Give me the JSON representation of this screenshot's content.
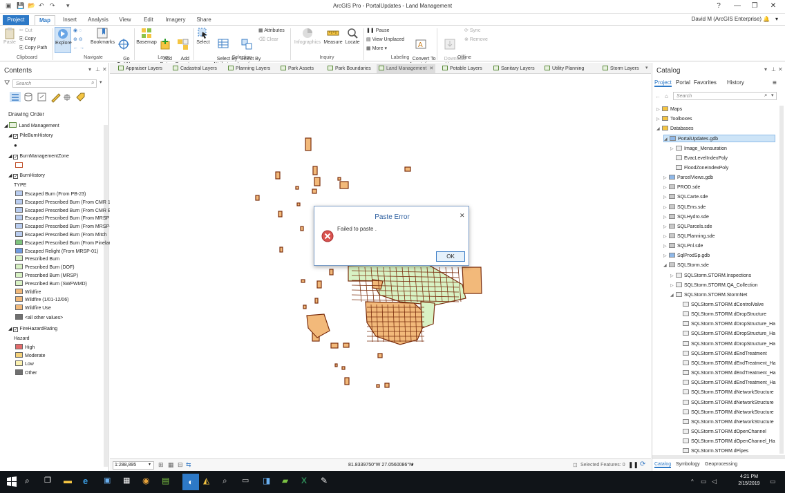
{
  "window": {
    "title": "ArcGIS Pro - PortalUpdates - Land Management",
    "user": "David M (ArcGIS Enterprise)",
    "help": "?"
  },
  "ribbon_tabs": [
    "Project",
    "Map",
    "Insert",
    "Analysis",
    "View",
    "Edit",
    "Imagery",
    "Share"
  ],
  "ribbon": {
    "clipboard": {
      "paste": "Paste",
      "cut": "Cut",
      "copy": "Copy",
      "copy_path": "Copy Path",
      "group": "Clipboard"
    },
    "navigate": {
      "explore": "Explore",
      "bookmarks": "Bookmarks",
      "goto": "Go\nTo XY",
      "group": "Navigate"
    },
    "layer": {
      "basemap": "Basemap",
      "add_data": "Add\nData",
      "add_preset": "Add\nPreset",
      "group": "Layer"
    },
    "selection": {
      "select": "Select",
      "by_attr": "Select By\nAttributes",
      "by_loc": "Select By\nLocation",
      "attributes": "Attributes",
      "clear": "Clear",
      "group": "Selection"
    },
    "inquiry": {
      "infographics": "Infographics",
      "measure": "Measure",
      "locate": "Locate",
      "group": "Inquiry"
    },
    "labeling": {
      "pause": "Pause",
      "view_unplaced": "View Unplaced",
      "more": "More",
      "convert": "Convert To\nAnnotation",
      "group": "Labeling"
    },
    "offline": {
      "download": "Download\nMap",
      "sync": "Sync",
      "remove": "Remove",
      "group": "Offline"
    }
  },
  "contents": {
    "title": "Contents",
    "search_placeholder": "Search",
    "drawing_order": "Drawing Order",
    "map": "Land Management",
    "layers": [
      {
        "name": "PileBurnHistory"
      },
      {
        "name": "BurnManagementZone"
      },
      {
        "name": "BurnHistory",
        "field": "TYPE",
        "classes": [
          {
            "label": "Escaped Burn (From PB-23)",
            "color": "#b9cdf0"
          },
          {
            "label": "Escaped Prescribed Burn (From CMR 1",
            "color": "#b9cdf0"
          },
          {
            "label": "Escaped Prescribed Burn (From CMR E",
            "color": "#b9cdf0"
          },
          {
            "label": "Escaped Prescribed Burn (From MRSP",
            "color": "#b9cdf0"
          },
          {
            "label": "Escaped Prescribed Burn (From MRSP-",
            "color": "#b9cdf0"
          },
          {
            "label": "Escaped Prescribed Burn (From Mitch",
            "color": "#b9cdf0"
          },
          {
            "label": "Escaped Prescribed Burn (From Pinelar",
            "color": "#7ec47e"
          },
          {
            "label": "Escaped Relight (From MRSP-01)",
            "color": "#6f9be0"
          },
          {
            "label": "Prescribed Burn",
            "color": "#d8f2c4"
          },
          {
            "label": "Prescribed Burn (DOF)",
            "color": "#d8f2c4"
          },
          {
            "label": "Prescribed Burn (MRSP)",
            "color": "#d8f2c4"
          },
          {
            "label": "Prescribed Burn (SWFWMD)",
            "color": "#d8f2c4"
          },
          {
            "label": "Wildfire",
            "color": "#f2b97a"
          },
          {
            "label": "Wildfire (1/01-12/06)",
            "color": "#f2b97a"
          },
          {
            "label": "Wildfire Use",
            "color": "#f2b97a"
          },
          {
            "label": "<all other values>",
            "color": "#707070"
          }
        ]
      },
      {
        "name": "FireHazardRating",
        "field": "Hazard",
        "classes": [
          {
            "label": "High",
            "color": "#e36b6b"
          },
          {
            "label": "Moderate",
            "color": "#f5d27a"
          },
          {
            "label": "Low",
            "color": "#fbf1b0"
          },
          {
            "label": "Other",
            "color": "#707070"
          }
        ]
      }
    ]
  },
  "view_tabs": [
    "Appraiser Layers",
    "Cadastral Layers",
    "Planning Layers",
    "Park Assets",
    "Park Boundaries",
    "Land Management",
    "Potable Layers",
    "Sanitary Layers",
    "Utility Planning",
    "Storm Layers"
  ],
  "active_view": "Land Management",
  "status": {
    "scale": "1:288,895",
    "coords": "81.8339750°W 27.0560086°N",
    "selected": "Selected Features: 0"
  },
  "catalog": {
    "title": "Catalog",
    "tabs": [
      "Project",
      "Portal",
      "Favorites",
      "History"
    ],
    "search_placeholder": "Search",
    "items": [
      {
        "label": "Maps",
        "indent": 0,
        "arrow": "▷"
      },
      {
        "label": "Toolboxes",
        "indent": 0,
        "arrow": "▷"
      },
      {
        "label": "Databases",
        "indent": 0,
        "arrow": "◢"
      },
      {
        "label": "PortalUpdates.gdb",
        "indent": 1,
        "arrow": "◢",
        "selected": true
      },
      {
        "label": "Image_Mensuration",
        "indent": 2,
        "arrow": "▷"
      },
      {
        "label": "EvacLevelIndexPoly",
        "indent": 2,
        "arrow": ""
      },
      {
        "label": "FloodZoneIndexPoly",
        "indent": 2,
        "arrow": ""
      },
      {
        "label": "ParcelViews.gdb",
        "indent": 1,
        "arrow": "▷"
      },
      {
        "label": "PROD.sde",
        "indent": 1,
        "arrow": "▷"
      },
      {
        "label": "SQLCarte.sde",
        "indent": 1,
        "arrow": "▷"
      },
      {
        "label": "SQLEms.sde",
        "indent": 1,
        "arrow": "▷"
      },
      {
        "label": "SQLHydro.sde",
        "indent": 1,
        "arrow": "▷"
      },
      {
        "label": "SQLParcels.sde",
        "indent": 1,
        "arrow": "▷"
      },
      {
        "label": "SQLPlanning.sde",
        "indent": 1,
        "arrow": "▷"
      },
      {
        "label": "SQLPnl.sde",
        "indent": 1,
        "arrow": "▷"
      },
      {
        "label": "SqlProdSp.gdb",
        "indent": 1,
        "arrow": "▷"
      },
      {
        "label": "SQLStorm.sde",
        "indent": 1,
        "arrow": "◢"
      },
      {
        "label": "SQLStorm.STORM.Inspections",
        "indent": 2,
        "arrow": "▷"
      },
      {
        "label": "SQLStorm.STORM.QA_Collection",
        "indent": 2,
        "arrow": "▷"
      },
      {
        "label": "SQLStorm.STORM.StormNet",
        "indent": 2,
        "arrow": "◢"
      },
      {
        "label": "SQLStorm.STORM.dControlValve",
        "indent": 3,
        "arrow": ""
      },
      {
        "label": "SQLStorm.STORM.dDropStructure",
        "indent": 3,
        "arrow": ""
      },
      {
        "label": "SQLStorm.STORM.dDropStructure_Ha",
        "indent": 3,
        "arrow": ""
      },
      {
        "label": "SQLStorm.STORM.dDropStructure_Ha",
        "indent": 3,
        "arrow": ""
      },
      {
        "label": "SQLStorm.STORM.dDropStructure_Ha",
        "indent": 3,
        "arrow": ""
      },
      {
        "label": "SQLStorm.STORM.dEndTreatment",
        "indent": 3,
        "arrow": ""
      },
      {
        "label": "SQLStorm.STORM.dEndTreatment_Ha",
        "indent": 3,
        "arrow": ""
      },
      {
        "label": "SQLStorm.STORM.dEndTreatment_Ha",
        "indent": 3,
        "arrow": ""
      },
      {
        "label": "SQLStorm.STORM.dEndTreatment_Ha",
        "indent": 3,
        "arrow": ""
      },
      {
        "label": "SQLStorm.STORM.dNetworkStructure",
        "indent": 3,
        "arrow": ""
      },
      {
        "label": "SQLStorm.STORM.dNetworkStructure",
        "indent": 3,
        "arrow": ""
      },
      {
        "label": "SQLStorm.STORM.dNetworkStructure",
        "indent": 3,
        "arrow": ""
      },
      {
        "label": "SQLStorm.STORM.dNetworkStructure",
        "indent": 3,
        "arrow": ""
      },
      {
        "label": "SQLStorm.STORM.dOpenChannel",
        "indent": 3,
        "arrow": ""
      },
      {
        "label": "SQLStorm.STORM.dOpenChannel_Ha",
        "indent": 3,
        "arrow": ""
      },
      {
        "label": "SQLStorm.STORM.dPipes",
        "indent": 3,
        "arrow": ""
      }
    ],
    "bottom_tabs": [
      "Catalog",
      "Symbology",
      "Geoprocessing"
    ]
  },
  "dialog": {
    "title": "Paste Error",
    "message": "Failed to paste .",
    "ok": "OK"
  },
  "taskbar": {
    "time": "4:21 PM",
    "date": "2/15/2019"
  },
  "colors": {
    "accent": "#2d79c7",
    "fire_fill": "#f2b97a",
    "fire_stroke": "#7a2e0e",
    "green_fill": "#d8f2c4",
    "error_red": "#d9534f"
  }
}
